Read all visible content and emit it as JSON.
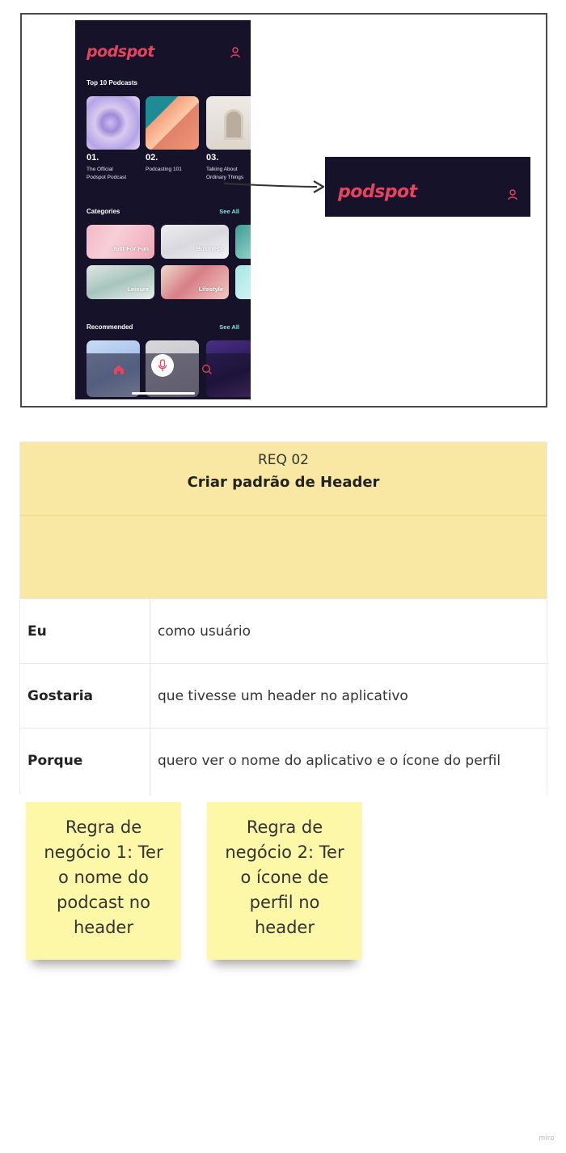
{
  "app": {
    "logo": "podspot",
    "top10_heading": "Top 10 Podcasts",
    "podcasts": [
      {
        "num": "01.",
        "title_line1": "The Official",
        "title_line2": "Podspot Podcast"
      },
      {
        "num": "02.",
        "title_line1": "Podcasting 101",
        "title_line2": ""
      },
      {
        "num": "03.",
        "title_line1": "Talking About",
        "title_line2": "Ordinary Things"
      }
    ],
    "categories_heading": "Categories",
    "see_all": "See All",
    "categories": [
      "Just For Fun",
      "Business",
      "Leisure",
      "Lifestyle"
    ],
    "recommended_heading": "Recommended",
    "icons": {
      "profile": "user-icon",
      "home": "home-icon",
      "mic": "microphone-icon",
      "search": "search-icon"
    }
  },
  "header_preview": {
    "logo": "podspot",
    "profile_icon": "user-icon"
  },
  "requirement": {
    "id": "REQ 02",
    "title": "Criar padrão de Header",
    "rows": [
      {
        "key": "Eu",
        "value": "como usuário"
      },
      {
        "key": "Gostaria",
        "value": "que tivesse um header no aplicativo"
      },
      {
        "key": "Porque",
        "value": "quero ver o nome do aplicativo e o ícone do perfil"
      }
    ]
  },
  "stickies": [
    {
      "lines": [
        "Regra de",
        "negócio 1: Ter",
        "o nome do",
        "podcast no",
        "header"
      ]
    },
    {
      "lines": [
        "Regra de",
        "negócio 2: Ter",
        "o ícone de",
        "perfil no",
        "header"
      ]
    }
  ],
  "watermark": "miro",
  "colors": {
    "app_bg": "#15122a",
    "brand": "#e8435e",
    "accent_link": "#7de3e3",
    "req_header": "#f9e7a4",
    "sticky": "#fdf8a8"
  }
}
